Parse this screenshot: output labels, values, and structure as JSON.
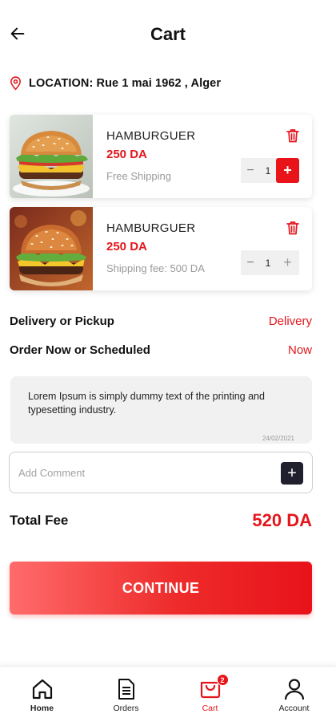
{
  "header": {
    "title": "Cart"
  },
  "location": {
    "text": "LOCATION: Rue 1 mai 1962 , Alger"
  },
  "cart_items": [
    {
      "name": "HAMBURGUER",
      "price": "250 DA",
      "note": "Free Shipping",
      "quantity": "1",
      "minus_symbol": "−",
      "plus_symbol": "+"
    },
    {
      "name": "HAMBURGUER",
      "price": "250 DA",
      "note": "Shipping fee: 500 DA",
      "quantity": "1",
      "minus_symbol": "−",
      "plus_symbol": "+"
    }
  ],
  "options": {
    "delivery": {
      "label": "Delivery or Pickup",
      "value": "Delivery"
    },
    "schedule": {
      "label": "Order Now or Scheduled",
      "value": "Now"
    }
  },
  "message": {
    "text": "Lorem Ipsum is simply dummy text of the printing and typesetting industry.",
    "date": "24/02/2021"
  },
  "comment": {
    "placeholder": "Add Comment",
    "value": "",
    "add_symbol": "+"
  },
  "total": {
    "label": "Total Fee",
    "value": "520 DA"
  },
  "continue_label": "CONTINUE",
  "nav": {
    "home": "Home",
    "orders": "Orders",
    "cart": "Cart",
    "cart_badge": "2",
    "account": "Account"
  },
  "colors": {
    "accent": "#e3161c",
    "dark_button": "#1f1f2e"
  }
}
